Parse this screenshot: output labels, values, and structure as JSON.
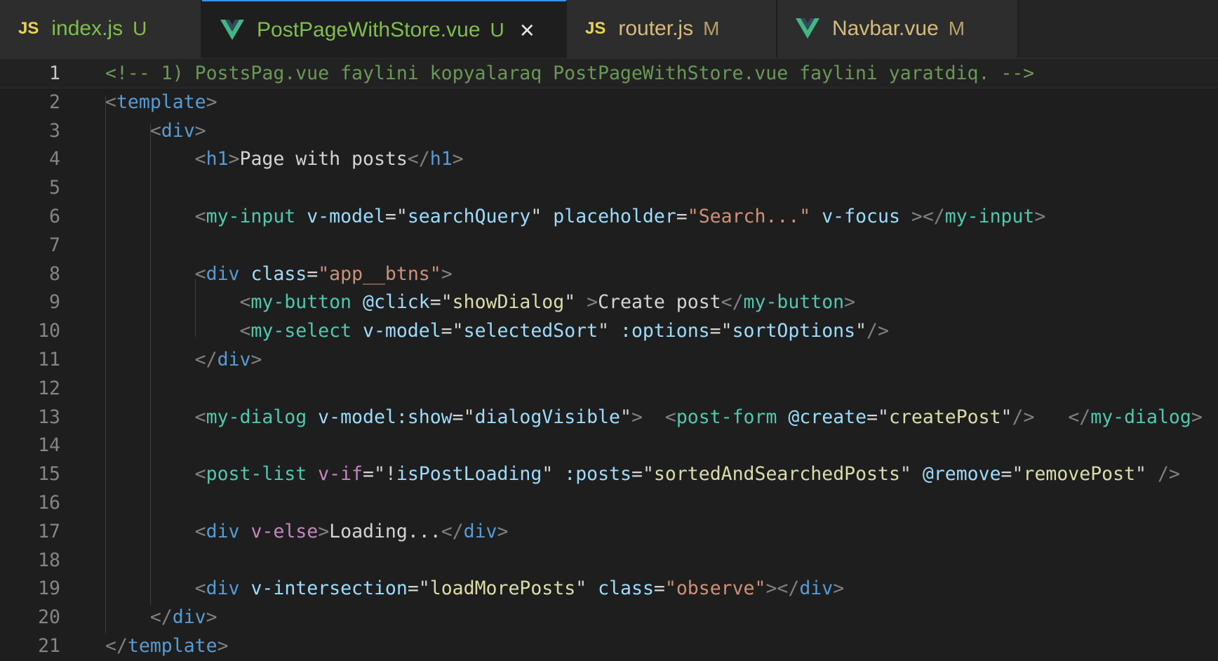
{
  "tabs": [
    {
      "name": "index.js",
      "status": "U",
      "type": "js",
      "name_color": "#7fbf4a",
      "status_color": "#7fbf4a",
      "active": false
    },
    {
      "name": "PostPageWithStore.vue",
      "status": "U",
      "type": "vue",
      "name_color": "#7fbf4a",
      "status_color": "#7fbf4a",
      "active": true
    },
    {
      "name": "router.js",
      "status": "M",
      "type": "js",
      "name_color": "#d7ba7d",
      "status_color": "#b8a06a",
      "active": false
    },
    {
      "name": "Navbar.vue",
      "status": "M",
      "type": "vue",
      "name_color": "#d7ba7d",
      "status_color": "#b8a06a",
      "active": false
    }
  ],
  "tab_icons": {
    "js": "JS",
    "vue": "vue-logo-icon",
    "close": "×"
  },
  "current_line": 1,
  "lines": [
    {
      "n": "1",
      "tokens": [
        [
          "comment",
          "<!-- 1) PostsPag.vue faylini kopyalaraq PostPageWithStore.vue faylini yaratdiq. -->"
        ]
      ]
    },
    {
      "n": "2",
      "tokens": [
        [
          "punct",
          "<"
        ],
        [
          "tag",
          "template"
        ],
        [
          "punct",
          ">"
        ]
      ]
    },
    {
      "n": "3",
      "tokens": [
        [
          "text",
          "    "
        ],
        [
          "punct",
          "<"
        ],
        [
          "tag",
          "div"
        ],
        [
          "punct",
          ">"
        ]
      ]
    },
    {
      "n": "4",
      "tokens": [
        [
          "text",
          "        "
        ],
        [
          "punct",
          "<"
        ],
        [
          "tag",
          "h1"
        ],
        [
          "punct",
          ">"
        ],
        [
          "text",
          "Page with posts"
        ],
        [
          "punct",
          "</"
        ],
        [
          "tag",
          "h1"
        ],
        [
          "punct",
          ">"
        ]
      ]
    },
    {
      "n": "5",
      "tokens": []
    },
    {
      "n": "6",
      "tokens": [
        [
          "text",
          "        "
        ],
        [
          "punct",
          "<"
        ],
        [
          "comp",
          "my-input"
        ],
        [
          "text",
          " "
        ],
        [
          "attr",
          "v-model"
        ],
        [
          "text",
          "="
        ],
        [
          "text",
          "\""
        ],
        [
          "attr",
          "searchQuery"
        ],
        [
          "text",
          "\""
        ],
        [
          "text",
          " "
        ],
        [
          "attr",
          "placeholder"
        ],
        [
          "text",
          "="
        ],
        [
          "str",
          "\"Search...\""
        ],
        [
          "text",
          " "
        ],
        [
          "attr",
          "v-focus"
        ],
        [
          "text",
          " "
        ],
        [
          "punct",
          "></"
        ],
        [
          "comp",
          "my-input"
        ],
        [
          "punct",
          ">"
        ]
      ]
    },
    {
      "n": "7",
      "tokens": []
    },
    {
      "n": "8",
      "tokens": [
        [
          "text",
          "        "
        ],
        [
          "punct",
          "<"
        ],
        [
          "tag",
          "div"
        ],
        [
          "text",
          " "
        ],
        [
          "attr",
          "class"
        ],
        [
          "text",
          "="
        ],
        [
          "str",
          "\"app__btns\""
        ],
        [
          "punct",
          ">"
        ]
      ]
    },
    {
      "n": "9",
      "tokens": [
        [
          "text",
          "            "
        ],
        [
          "punct",
          "<"
        ],
        [
          "comp",
          "my-button"
        ],
        [
          "text",
          " "
        ],
        [
          "attr",
          "@click"
        ],
        [
          "text",
          "="
        ],
        [
          "text",
          "\""
        ],
        [
          "jsstr",
          "showDialog"
        ],
        [
          "text",
          "\""
        ],
        [
          "text",
          " "
        ],
        [
          "punct",
          ">"
        ],
        [
          "text",
          "Create post"
        ],
        [
          "punct",
          "</"
        ],
        [
          "comp",
          "my-button"
        ],
        [
          "punct",
          ">"
        ]
      ]
    },
    {
      "n": "10",
      "tokens": [
        [
          "text",
          "            "
        ],
        [
          "punct",
          "<"
        ],
        [
          "comp",
          "my-select"
        ],
        [
          "text",
          " "
        ],
        [
          "attr",
          "v-model"
        ],
        [
          "text",
          "="
        ],
        [
          "text",
          "\""
        ],
        [
          "attr",
          "selectedSort"
        ],
        [
          "text",
          "\""
        ],
        [
          "text",
          " "
        ],
        [
          "attr",
          ":options"
        ],
        [
          "text",
          "="
        ],
        [
          "text",
          "\""
        ],
        [
          "attr",
          "sortOptions"
        ],
        [
          "text",
          "\""
        ],
        [
          "punct",
          "/>"
        ]
      ]
    },
    {
      "n": "11",
      "tokens": [
        [
          "text",
          "        "
        ],
        [
          "punct",
          "</"
        ],
        [
          "tag",
          "div"
        ],
        [
          "punct",
          ">"
        ]
      ]
    },
    {
      "n": "12",
      "tokens": []
    },
    {
      "n": "13",
      "tokens": [
        [
          "text",
          "        "
        ],
        [
          "punct",
          "<"
        ],
        [
          "comp",
          "my-dialog"
        ],
        [
          "text",
          " "
        ],
        [
          "attr",
          "v-model:show"
        ],
        [
          "text",
          "="
        ],
        [
          "text",
          "\""
        ],
        [
          "attr",
          "dialogVisible"
        ],
        [
          "text",
          "\""
        ],
        [
          "punct",
          ">"
        ],
        [
          "text",
          "  "
        ],
        [
          "punct",
          "<"
        ],
        [
          "comp",
          "post-form"
        ],
        [
          "text",
          " "
        ],
        [
          "attr",
          "@create"
        ],
        [
          "text",
          "="
        ],
        [
          "text",
          "\""
        ],
        [
          "jsstr",
          "createPost"
        ],
        [
          "text",
          "\""
        ],
        [
          "punct",
          "/>"
        ],
        [
          "text",
          "   "
        ],
        [
          "punct",
          "</"
        ],
        [
          "comp",
          "my-dialog"
        ],
        [
          "punct",
          ">"
        ]
      ]
    },
    {
      "n": "14",
      "tokens": []
    },
    {
      "n": "15",
      "tokens": [
        [
          "text",
          "        "
        ],
        [
          "punct",
          "<"
        ],
        [
          "comp",
          "post-list"
        ],
        [
          "text",
          " "
        ],
        [
          "dir",
          "v-if"
        ],
        [
          "text",
          "="
        ],
        [
          "text",
          "\"!"
        ],
        [
          "attr",
          "isPostLoading"
        ],
        [
          "text",
          "\""
        ],
        [
          "text",
          " "
        ],
        [
          "attr",
          ":posts"
        ],
        [
          "text",
          "="
        ],
        [
          "text",
          "\""
        ],
        [
          "jsstr",
          "sortedAndSearchedPosts"
        ],
        [
          "text",
          "\""
        ],
        [
          "text",
          " "
        ],
        [
          "attr",
          "@remove"
        ],
        [
          "text",
          "="
        ],
        [
          "text",
          "\""
        ],
        [
          "jsstr",
          "removePost"
        ],
        [
          "text",
          "\""
        ],
        [
          "text",
          " "
        ],
        [
          "punct",
          "/>"
        ]
      ]
    },
    {
      "n": "16",
      "tokens": []
    },
    {
      "n": "17",
      "tokens": [
        [
          "text",
          "        "
        ],
        [
          "punct",
          "<"
        ],
        [
          "tag",
          "div"
        ],
        [
          "text",
          " "
        ],
        [
          "dir",
          "v-else"
        ],
        [
          "punct",
          ">"
        ],
        [
          "text",
          "Loading..."
        ],
        [
          "punct",
          "</"
        ],
        [
          "tag",
          "div"
        ],
        [
          "punct",
          ">"
        ]
      ]
    },
    {
      "n": "18",
      "tokens": []
    },
    {
      "n": "19",
      "tokens": [
        [
          "text",
          "        "
        ],
        [
          "punct",
          "<"
        ],
        [
          "tag",
          "div"
        ],
        [
          "text",
          " "
        ],
        [
          "attr",
          "v-intersection"
        ],
        [
          "text",
          "="
        ],
        [
          "text",
          "\""
        ],
        [
          "jsstr",
          "loadMorePosts"
        ],
        [
          "text",
          "\""
        ],
        [
          "text",
          " "
        ],
        [
          "attr",
          "class"
        ],
        [
          "text",
          "="
        ],
        [
          "str",
          "\"observe\""
        ],
        [
          "punct",
          "></"
        ],
        [
          "tag",
          "div"
        ],
        [
          "punct",
          ">"
        ]
      ]
    },
    {
      "n": "20",
      "tokens": [
        [
          "text",
          "    "
        ],
        [
          "punct",
          "</"
        ],
        [
          "tag",
          "div"
        ],
        [
          "punct",
          ">"
        ]
      ]
    },
    {
      "n": "21",
      "tokens": [
        [
          "punct",
          "</"
        ],
        [
          "tag",
          "template"
        ],
        [
          "punct",
          ">"
        ]
      ]
    }
  ]
}
